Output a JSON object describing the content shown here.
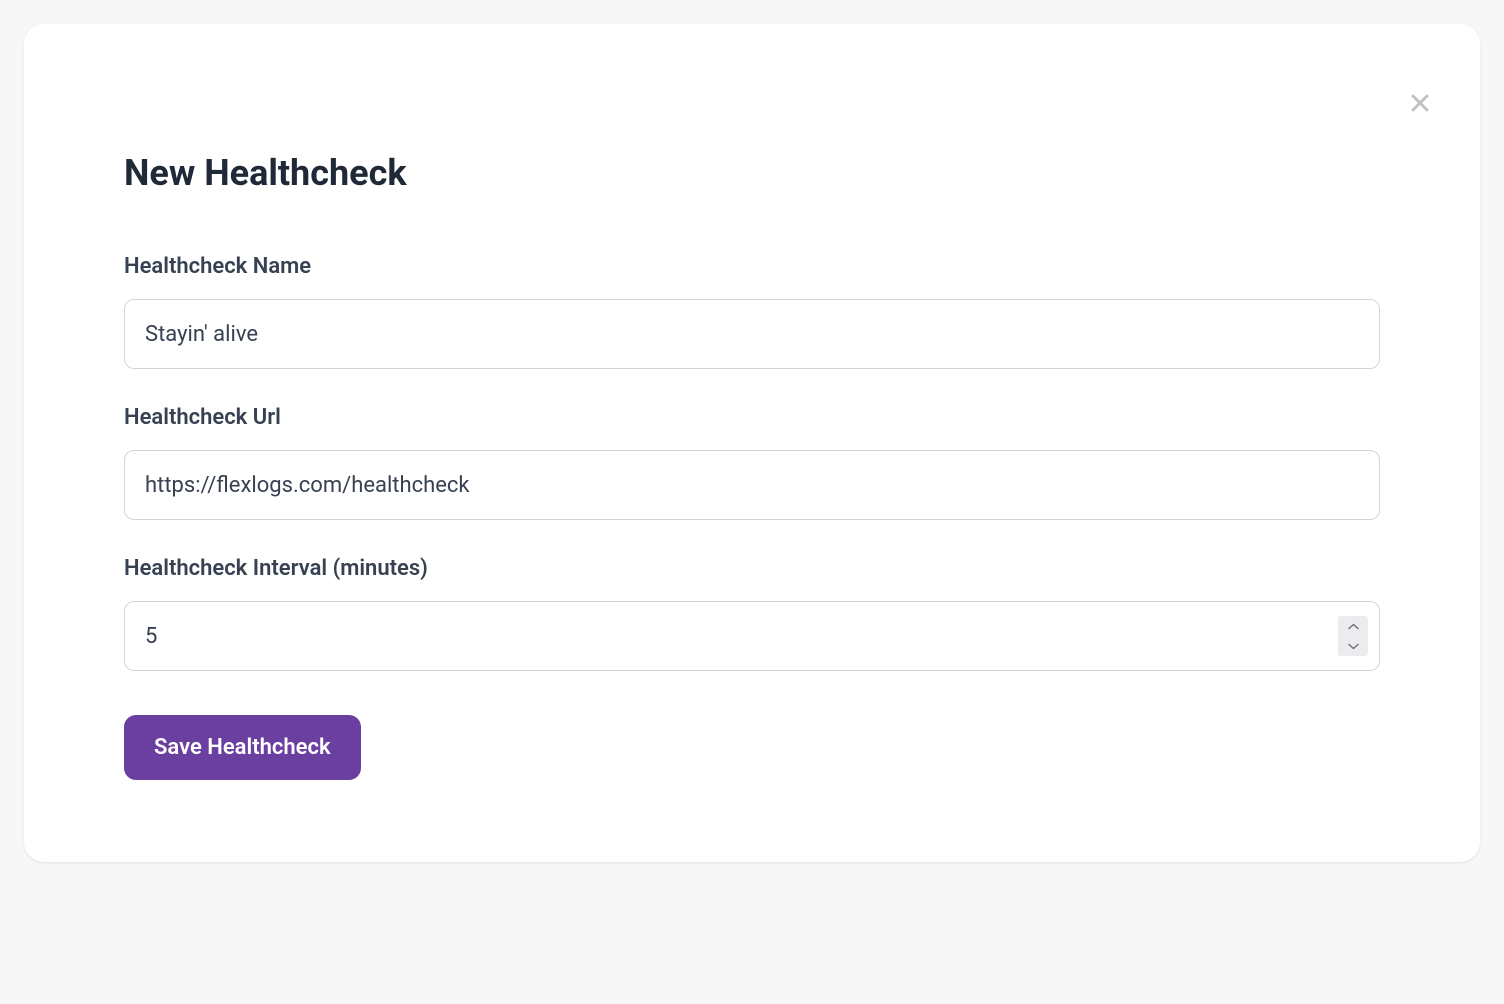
{
  "modal": {
    "title": "New Healthcheck",
    "fields": {
      "name": {
        "label": "Healthcheck Name",
        "placeholder": "Stayin' alive",
        "value": ""
      },
      "url": {
        "label": "Healthcheck Url",
        "placeholder": "https://flexlogs.com/healthcheck",
        "value": ""
      },
      "interval": {
        "label": "Healthcheck Interval (minutes)",
        "value": "5"
      }
    },
    "actions": {
      "save_label": "Save Healthcheck"
    }
  }
}
